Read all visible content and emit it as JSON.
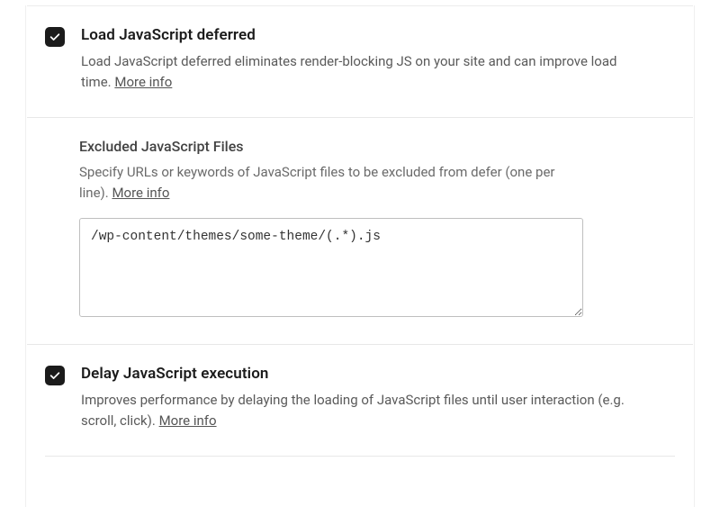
{
  "sections": {
    "defer": {
      "title": "Load JavaScript deferred",
      "desc": "Load JavaScript deferred eliminates render-blocking JS on your site and can improve load time.",
      "more": "More info",
      "checked": true
    },
    "excluded": {
      "title": "Excluded JavaScript Files",
      "desc": "Specify URLs or keywords of JavaScript files to be excluded from defer (one per line).",
      "more": "More info",
      "value": "/wp-content/themes/some-theme/(.*).js"
    },
    "delay": {
      "title": "Delay JavaScript execution",
      "desc": "Improves performance by delaying the loading of JavaScript files until user interaction (e.g. scroll, click).",
      "more": "More info",
      "checked": true
    }
  }
}
